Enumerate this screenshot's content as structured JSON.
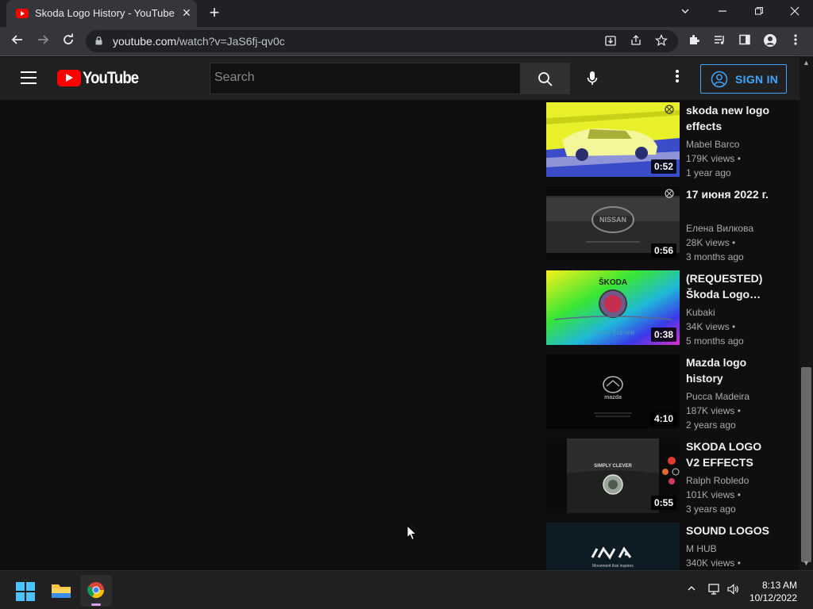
{
  "browser": {
    "tab_title": "Skoda Logo History - YouTube",
    "url_host": "youtube.com",
    "url_path": "/watch?v=JaS6fj-qv0c"
  },
  "youtube": {
    "wordmark": "YouTube",
    "search_placeholder": "Search",
    "signin_label": "SIGN IN",
    "accent_color": "#3ea6ff",
    "brand_color": "#ff0000"
  },
  "recommendations": [
    {
      "title": "skoda new logo effects",
      "channel": "Mabel Barco",
      "views": "179K views",
      "age": "1 year ago",
      "duration": "0:52",
      "thumb_text": ""
    },
    {
      "title": "17 июня 2022 г.",
      "channel": "Елена Вилкова",
      "views": "28K views",
      "age": "3 months ago",
      "duration": "0:56",
      "thumb_text": "NISSAN"
    },
    {
      "title": "(REQUESTED) Škoda Logo…",
      "channel": "Kubaki",
      "views": "34K views",
      "age": "5 months ago",
      "duration": "0:38",
      "thumb_text": "ŠKODA",
      "thumb_subtext": "SIMPLY CLEVER"
    },
    {
      "title": "Mazda logo history",
      "channel": "Pucca Madeira",
      "views": "187K views",
      "age": "2 years ago",
      "duration": "4:10",
      "thumb_text": "mazda"
    },
    {
      "title": "SKODA LOGO V2 EFFECTS S…",
      "channel": "Ralph Robledo",
      "views": "101K views",
      "age": "3 years ago",
      "duration": "0:55",
      "thumb_text": "SIMPLY CLEVER"
    },
    {
      "title": "SOUND LOGOS",
      "channel": "M HUB",
      "views": "340K views",
      "age": "",
      "duration": "",
      "thumb_text": "KIA",
      "thumb_subtext": "Movement that inspires"
    }
  ],
  "taskbar": {
    "time": "8:13 AM",
    "date": "10/12/2022"
  }
}
